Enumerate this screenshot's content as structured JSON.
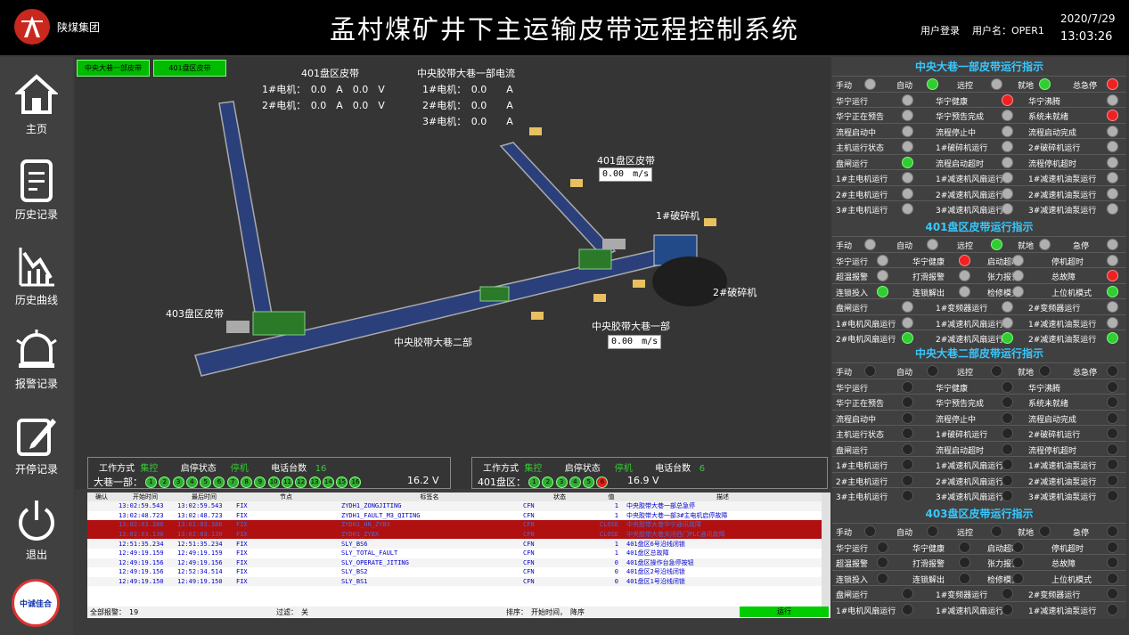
{
  "header": {
    "company": "陕煤集团",
    "title": "孟村煤矿井下主运输皮带远程控制系统",
    "login": "用户登录",
    "username": "用户名：OPER1",
    "date": "2020/7/29",
    "time": "13:03:26"
  },
  "nav": [
    {
      "label": "主页",
      "icon": "home-icon"
    },
    {
      "label": "历史记录",
      "icon": "document-icon"
    },
    {
      "label": "历史曲线",
      "icon": "curve-icon"
    },
    {
      "label": "报警记录",
      "icon": "alarm-bell-icon"
    },
    {
      "label": "开停记录",
      "icon": "edit-icon"
    },
    {
      "label": "退出",
      "icon": "power-icon"
    }
  ],
  "footer_logo": "中诚佳合",
  "tabs": [
    "中央大巷一部皮带",
    "401盘区皮带"
  ],
  "currents": {
    "b401": {
      "title": "401盘区皮带",
      "m1": "1#电机：　0.0　A　0.0　V",
      "m2": "2#电机：　0.0　A　0.0　V"
    },
    "central": {
      "title": "中央胶带大巷一部电流",
      "m1": "1#电机：　0.0　　A",
      "m2": "2#电机：　0.0　　A",
      "m3": "3#电机：　0.0　　A"
    }
  },
  "diagram_labels": {
    "b401": "401盘区皮带",
    "speed401": "0.00　m/s",
    "crusher1": "1#破碎机",
    "crusher2": "2#破碎机",
    "b403": "403盘区皮带",
    "central2": "中央胶带大巷二部",
    "central1": "中央胶带大巷一部",
    "speedC1": "0.00　m/s"
  },
  "info_left": {
    "mode_label": "工作方式",
    "mode": "集控",
    "start_label": "启停状态",
    "start": "停机",
    "phone_label": "电话台数",
    "phone": "16",
    "line_label": "大巷一部：",
    "circles": [
      "1",
      "2",
      "3",
      "4",
      "5",
      "6",
      "7",
      "8",
      "9",
      "10",
      "11",
      "12",
      "13",
      "14",
      "15",
      "16"
    ],
    "red_index": null,
    "value": "16.2 V"
  },
  "info_right": {
    "mode_label": "工作方式",
    "mode": "集控",
    "start_label": "启停状态",
    "start": "停机",
    "phone_label": "电话台数",
    "phone": "6",
    "line_label": "401盘区：",
    "circles": [
      "1",
      "2",
      "3",
      "4",
      "5",
      "6"
    ],
    "red_index": 5,
    "value": "16.9 V"
  },
  "alarm_table": {
    "headers": [
      "确认",
      "开始时间",
      "最后时间",
      "节点",
      "标签名",
      "状态",
      "值",
      "描述"
    ],
    "rows": [
      [
        "",
        "13:02:59.543",
        "13:02:59.543",
        "FIX",
        "ZYDH1_ZONGJITING",
        "CFN",
        "1",
        "中央胶带大巷一部总急停"
      ],
      [
        "",
        "13:02:48.723",
        "13:02:48.723",
        "FIX",
        "ZYDH1_FAULT_M3_QITING",
        "CFN",
        "1",
        "中央胶带大巷一部3#主电机启停故障"
      ],
      [
        "",
        "13:02:03.386",
        "13:02:03.386",
        "FIX",
        "ZYDH1_HN_ZYBX",
        "CFN",
        "CLOSE",
        "中央胶带大巷华宁通讯故障"
      ],
      [
        "",
        "13:02:03.130",
        "13:02:03.130",
        "FIX",
        "ZYDH1_ZYBX",
        "CFN",
        "CLOSE",
        "中央胶带大巷关闭西门PLC通讯故障"
      ],
      [
        "",
        "12:51:35.234",
        "12:51:35.234",
        "FIX",
        "SLY_BS6",
        "CFN",
        "1",
        "401盘区6号沿线闭锁"
      ],
      [
        "",
        "12:49:19.159",
        "12:49:19.159",
        "FIX",
        "SLY_TOTAL_FAULT",
        "CFN",
        "1",
        "401盘区总故障"
      ],
      [
        "",
        "12:49:19.156",
        "12:49:19.156",
        "FIX",
        "SLY_OPERATE_JITING",
        "CFN",
        "0",
        "401盘区操作台急停按钮"
      ],
      [
        "",
        "12:49:19.156",
        "12:52:34.514",
        "FIX",
        "SLY_BS2",
        "CFN",
        "0",
        "401盘区2号沿线闭锁"
      ],
      [
        "",
        "12:49:19.150",
        "12:49:19.150",
        "FIX",
        "SLY_BS1",
        "CFN",
        "0",
        "401盘区1号沿线闭锁"
      ]
    ],
    "red_rows": [
      2,
      3
    ],
    "footer": {
      "count": "全部报警：　19",
      "filter": "过滤：　关",
      "sort": "排序：　开始时间，　降序",
      "status": "运行"
    }
  },
  "panels": {
    "p1": {
      "title": "中央大巷一部皮带运行指示",
      "rows": [
        [
          [
            "手动",
            "x"
          ],
          [
            "自动",
            "g"
          ],
          [
            "远控",
            "x"
          ],
          [
            "就地",
            "g"
          ],
          [
            "总急停",
            "r"
          ]
        ],
        [
          [
            "华宁运行",
            "x"
          ],
          [
            "华宁健康",
            "r"
          ],
          [
            "华宁沸腾",
            "x"
          ]
        ],
        [
          [
            "华宁正在预告",
            "x"
          ],
          [
            "华宁预告完成",
            "x"
          ],
          [
            "系统未就绪",
            "r"
          ]
        ],
        [
          [
            "流程启动中",
            "x"
          ],
          [
            "流程停止中",
            "x"
          ],
          [
            "流程启动完成",
            "x"
          ]
        ],
        [
          [
            "主机运行状态",
            "x"
          ],
          [
            "1#破碎机运行",
            "x"
          ],
          [
            "2#破碎机运行",
            "x"
          ]
        ],
        [
          [
            "盘闸运行",
            "g"
          ],
          [
            "流程启动超时",
            "x"
          ],
          [
            "流程停机超时",
            "x"
          ]
        ],
        [
          [
            "1#主电机运行",
            "x"
          ],
          [
            "1#减速机风扇运行",
            "x"
          ],
          [
            "1#减速机油泵运行",
            "x"
          ]
        ],
        [
          [
            "2#主电机运行",
            "x"
          ],
          [
            "2#减速机风扇运行",
            "x"
          ],
          [
            "2#减速机油泵运行",
            "x"
          ]
        ],
        [
          [
            "3#主电机运行",
            "x"
          ],
          [
            "3#减速机风扇运行",
            "x"
          ],
          [
            "3#减速机油泵运行",
            "x"
          ]
        ]
      ]
    },
    "p2": {
      "title": "401盘区皮带运行指示",
      "rows": [
        [
          [
            "手动",
            "x"
          ],
          [
            "自动",
            "x"
          ],
          [
            "远控",
            "g"
          ],
          [
            "就地",
            "x"
          ],
          [
            "急停",
            "x"
          ]
        ],
        [
          [
            "华宁运行",
            "x"
          ],
          [
            "华宁健康",
            "r"
          ],
          [
            "启动超时",
            "x"
          ],
          [
            "停机超时",
            "x"
          ]
        ],
        [
          [
            "超温报警",
            "x"
          ],
          [
            "打滑报警",
            "x"
          ],
          [
            "张力报警",
            "x"
          ],
          [
            "总故障",
            "r"
          ]
        ],
        [
          [
            "连锁投入",
            "g"
          ],
          [
            "连锁解出",
            "x"
          ],
          [
            "检修模式",
            "x"
          ],
          [
            "上位机模式",
            "g"
          ]
        ],
        [
          [
            "盘闸运行",
            "x"
          ],
          [
            "1#变频器运行",
            "x"
          ],
          [
            "2#变频器运行",
            "x"
          ]
        ],
        [
          [
            "1#电机风扇运行",
            "x"
          ],
          [
            "1#减速机风扇运行",
            "x"
          ],
          [
            "1#减速机油泵运行",
            "x"
          ]
        ],
        [
          [
            "2#电机风扇运行",
            "g"
          ],
          [
            "2#减速机风扇运行",
            "g"
          ],
          [
            "2#减速机油泵运行",
            "g"
          ]
        ]
      ]
    },
    "p3": {
      "title": "中央大巷二部皮带运行指示",
      "rows": [
        [
          [
            "手动",
            "k"
          ],
          [
            "自动",
            "k"
          ],
          [
            "远控",
            "k"
          ],
          [
            "就地",
            "k"
          ],
          [
            "总急停",
            "k"
          ]
        ],
        [
          [
            "华宁运行",
            "k"
          ],
          [
            "华宁健康",
            "k"
          ],
          [
            "华宁沸腾",
            "k"
          ]
        ],
        [
          [
            "华宁正在预告",
            "k"
          ],
          [
            "华宁预告完成",
            "k"
          ],
          [
            "系统未就绪",
            "k"
          ]
        ],
        [
          [
            "流程启动中",
            "k"
          ],
          [
            "流程停止中",
            "k"
          ],
          [
            "流程启动完成",
            "k"
          ]
        ],
        [
          [
            "主机运行状态",
            "k"
          ],
          [
            "1#破碎机运行",
            "k"
          ],
          [
            "2#破碎机运行",
            "k"
          ]
        ],
        [
          [
            "盘闸运行",
            "k"
          ],
          [
            "流程启动超时",
            "k"
          ],
          [
            "流程停机超时",
            "k"
          ]
        ],
        [
          [
            "1#主电机运行",
            "k"
          ],
          [
            "1#减速机风扇运行",
            "k"
          ],
          [
            "1#减速机油泵运行",
            "k"
          ]
        ],
        [
          [
            "2#主电机运行",
            "k"
          ],
          [
            "2#减速机风扇运行",
            "k"
          ],
          [
            "2#减速机油泵运行",
            "k"
          ]
        ],
        [
          [
            "3#主电机运行",
            "k"
          ],
          [
            "3#减速机风扇运行",
            "k"
          ],
          [
            "3#减速机油泵运行",
            "k"
          ]
        ]
      ]
    },
    "p4": {
      "title": "403盘区皮带运行指示",
      "rows": [
        [
          [
            "手动",
            "k"
          ],
          [
            "自动",
            "k"
          ],
          [
            "远控",
            "k"
          ],
          [
            "就地",
            "k"
          ],
          [
            "急停",
            "k"
          ]
        ],
        [
          [
            "华宁运行",
            "k"
          ],
          [
            "华宁健康",
            "k"
          ],
          [
            "启动超时",
            "k"
          ],
          [
            "停机超时",
            "k"
          ]
        ],
        [
          [
            "超温报警",
            "k"
          ],
          [
            "打滑报警",
            "k"
          ],
          [
            "张力报警",
            "k"
          ],
          [
            "总故障",
            "k"
          ]
        ],
        [
          [
            "连锁投入",
            "k"
          ],
          [
            "连锁解出",
            "k"
          ],
          [
            "检修模式",
            "k"
          ],
          [
            "上位机模式",
            "k"
          ]
        ],
        [
          [
            "盘闸运行",
            "k"
          ],
          [
            "1#变频器运行",
            "k"
          ],
          [
            "2#变频器运行",
            "k"
          ]
        ],
        [
          [
            "1#电机风扇运行",
            "k"
          ],
          [
            "1#减速机风扇运行",
            "k"
          ],
          [
            "1#减速机油泵运行",
            "k"
          ]
        ]
      ]
    }
  }
}
